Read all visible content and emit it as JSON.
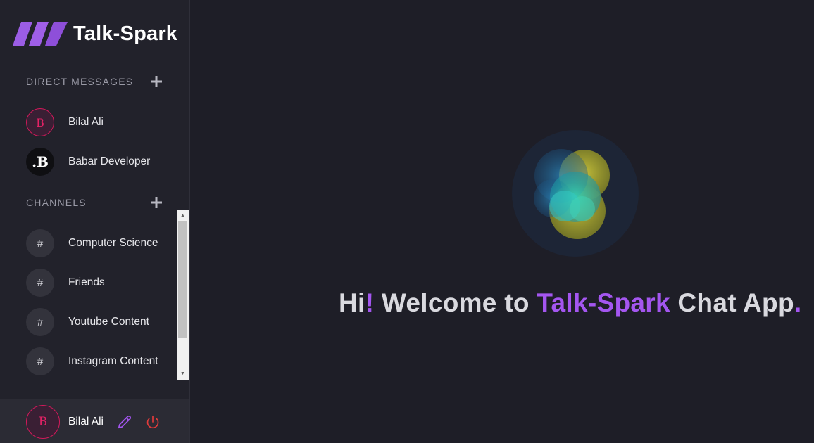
{
  "brand": {
    "name": "Talk-Spark"
  },
  "direct_messages": {
    "title": "DIRECT MESSAGES",
    "items": [
      {
        "initial": "B",
        "name": "Bilal Ali",
        "avatar_style": "pink-outline"
      },
      {
        "initial": ".B",
        "name": "Babar Developer",
        "avatar_style": "dark-logo"
      }
    ]
  },
  "channels": {
    "title": "CHANNELS",
    "items": [
      {
        "symbol": "#",
        "name": "Computer Science"
      },
      {
        "symbol": "#",
        "name": "Friends"
      },
      {
        "symbol": "#",
        "name": "Youtube Content"
      },
      {
        "symbol": "#",
        "name": "Instagram Content"
      }
    ]
  },
  "current_user": {
    "initial": "B",
    "name": "Bilal Ali"
  },
  "welcome": {
    "hi": "Hi",
    "exclaim": "!",
    "welcome_to": " Welcome to ",
    "app_name": "Talk-Spark",
    "chat_app": " Chat App",
    "period": "."
  },
  "colors": {
    "accent": "#a456f0",
    "sidebar_bg": "#22222b",
    "main_bg": "#1e1e27",
    "danger": "#e23b3b",
    "avatar_pink": "#e52266"
  },
  "icons": {
    "add": "plus-icon",
    "edit": "pencil-icon",
    "logout": "power-icon",
    "logo": "slanted-bars-logo"
  }
}
